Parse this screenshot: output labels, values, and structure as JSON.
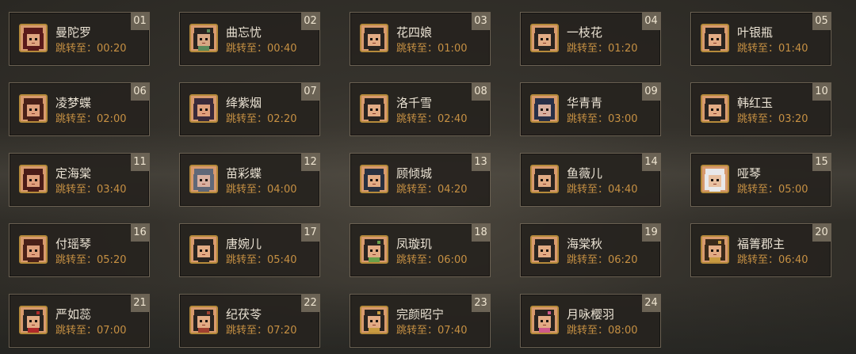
{
  "jump_prefix": "跳转至：",
  "characters": [
    {
      "id": "01",
      "name": "曼陀罗",
      "time": "00:20",
      "hair": "#5a1a1a",
      "skin": "#e0a580"
    },
    {
      "id": "02",
      "name": "曲忘忧",
      "time": "00:40",
      "hair": "#2a2420",
      "skin": "#d8a884",
      "accent": "#5c8a5a"
    },
    {
      "id": "03",
      "name": "花四娘",
      "time": "01:00",
      "hair": "#2a2420",
      "skin": "#e2ab84"
    },
    {
      "id": "04",
      "name": "一枝花",
      "time": "01:20",
      "hair": "#2a2420",
      "skin": "#e2ab84"
    },
    {
      "id": "05",
      "name": "叶银瓶",
      "time": "01:40",
      "hair": "#2a2420",
      "skin": "#e2ab84"
    },
    {
      "id": "06",
      "name": "凌梦蝶",
      "time": "02:00",
      "hair": "#4a2018",
      "skin": "#dfa07c"
    },
    {
      "id": "07",
      "name": "绛紫烟",
      "time": "02:20",
      "hair": "#3a2a3a",
      "skin": "#dfa07c"
    },
    {
      "id": "08",
      "name": "洛千雪",
      "time": "02:40",
      "hair": "#2a2420",
      "skin": "#e2ab84"
    },
    {
      "id": "09",
      "name": "华青青",
      "time": "03:00",
      "hair": "#283048",
      "skin": "#d8b0a0"
    },
    {
      "id": "10",
      "name": "韩红玉",
      "time": "03:20",
      "hair": "#2a2420",
      "skin": "#e2ab84"
    },
    {
      "id": "11",
      "name": "定海棠",
      "time": "03:40",
      "hair": "#4a1c18",
      "skin": "#dfa07c"
    },
    {
      "id": "12",
      "name": "苗彩蝶",
      "time": "04:00",
      "hair": "#606878",
      "skin": "#d8b0a0"
    },
    {
      "id": "13",
      "name": "顾倾城",
      "time": "04:20",
      "hair": "#283040",
      "skin": "#e2ab84"
    },
    {
      "id": "14",
      "name": "鱼薇儿",
      "time": "04:40",
      "hair": "#2a2420",
      "skin": "#e2ab84"
    },
    {
      "id": "15",
      "name": "哑琴",
      "time": "05:00",
      "hair": "#e8e8ea",
      "skin": "#e8c0a0"
    },
    {
      "id": "16",
      "name": "付瑶琴",
      "time": "05:20",
      "hair": "#4a2018",
      "skin": "#dfa07c"
    },
    {
      "id": "17",
      "name": "唐婉儿",
      "time": "05:40",
      "hair": "#2a2420",
      "skin": "#e2ab84"
    },
    {
      "id": "18",
      "name": "凤璇玑",
      "time": "06:00",
      "hair": "#2a2420",
      "skin": "#e2ab84",
      "accent": "#6aa04a"
    },
    {
      "id": "19",
      "name": "海棠秋",
      "time": "06:20",
      "hair": "#2a2420",
      "skin": "#e2ab84"
    },
    {
      "id": "20",
      "name": "福箐郡主",
      "time": "06:40",
      "hair": "#3a2a1a",
      "skin": "#e2ab84",
      "accent": "#c89a40"
    },
    {
      "id": "21",
      "name": "严如蕊",
      "time": "07:00",
      "hair": "#2a2420",
      "skin": "#e2ab84",
      "accent": "#b02a2a"
    },
    {
      "id": "22",
      "name": "纪茯苓",
      "time": "07:20",
      "hair": "#2a2420",
      "skin": "#e2ab84",
      "accent": "#a04030"
    },
    {
      "id": "23",
      "name": "完颜昭宁",
      "time": "07:40",
      "hair": "#2a2420",
      "skin": "#e2ab84",
      "accent": "#c89a40"
    },
    {
      "id": "24",
      "name": "月咏樱羽",
      "time": "08:00",
      "hair": "#2a2420",
      "skin": "#e2ab84",
      "accent": "#d05a8a"
    }
  ]
}
